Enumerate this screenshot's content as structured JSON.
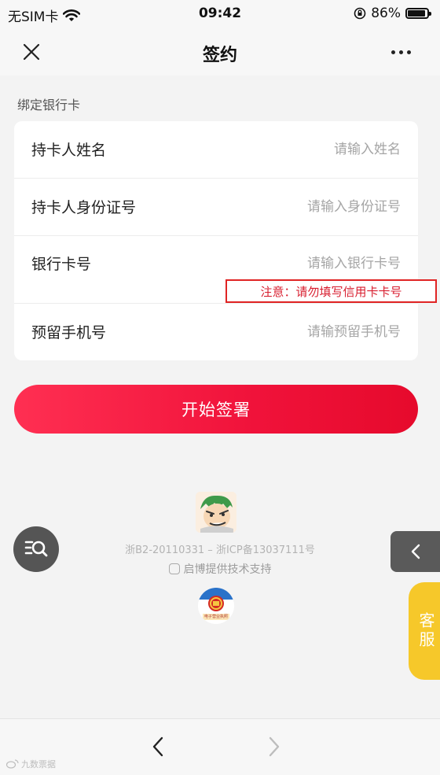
{
  "status_bar": {
    "carrier": "无SIM卡",
    "time": "09:42",
    "battery_text": "86%",
    "battery_level": 0.86
  },
  "nav": {
    "title": "签约"
  },
  "form": {
    "section_label": "绑定银行卡",
    "fields": [
      {
        "label": "持卡人姓名",
        "placeholder": "请输入姓名",
        "value": ""
      },
      {
        "label": "持卡人身份证号",
        "placeholder": "请输入身份证号",
        "value": ""
      },
      {
        "label": "银行卡号",
        "placeholder": "请输入银行卡号",
        "value": ""
      },
      {
        "label": "预留手机号",
        "placeholder": "请输预留手机号",
        "value": ""
      }
    ],
    "notice": "注意：请勿填写信用卡卡号",
    "submit_label": "开始签署"
  },
  "footer": {
    "license": "浙B2-20110331 – 浙ICP备13037111号",
    "powered_by": "启博提供技术支持",
    "emblem_caption": "电子营业执照"
  },
  "floating": {
    "service_label": "客服"
  },
  "watermark": "九数票据",
  "colors": {
    "accent": "#f0123a",
    "notice_border": "#e02424",
    "service_tab": "#f6c82a"
  }
}
